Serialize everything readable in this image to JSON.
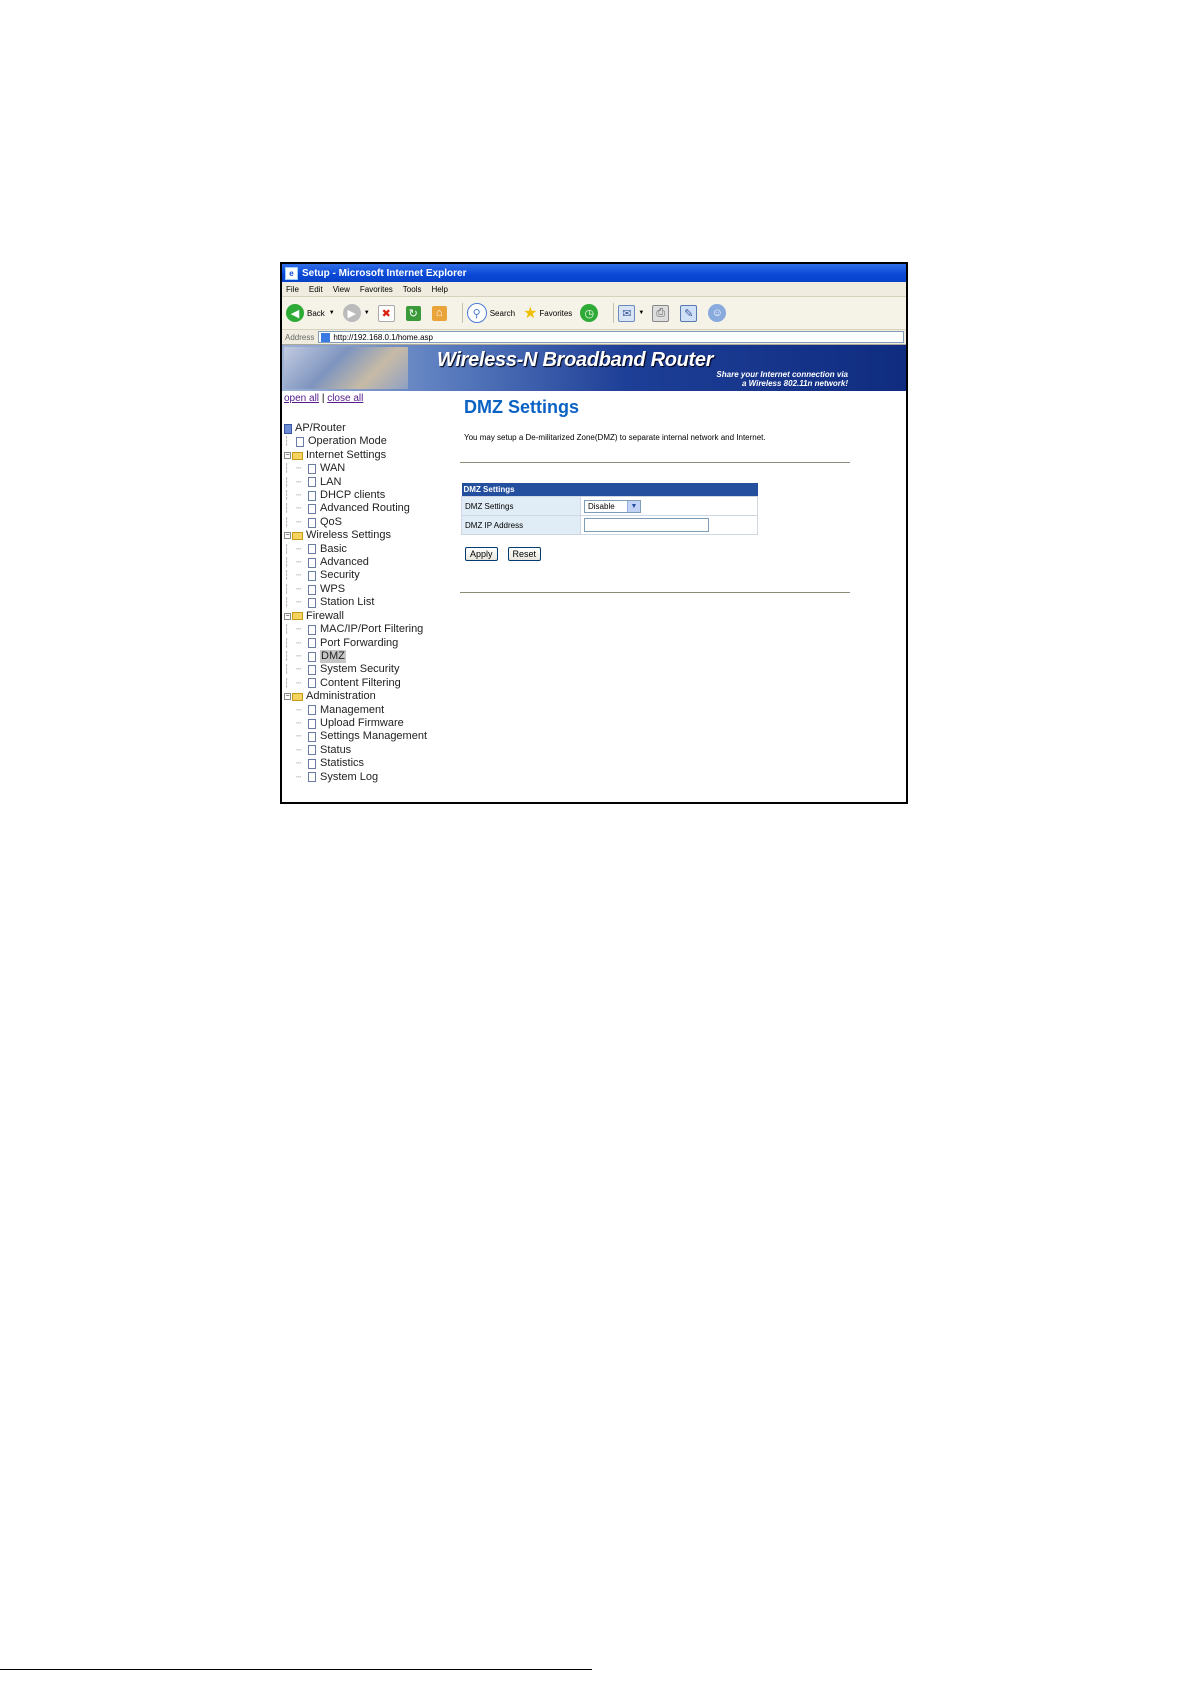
{
  "window": {
    "title": "Setup - Microsoft Internet Explorer"
  },
  "menu": [
    "File",
    "Edit",
    "View",
    "Favorites",
    "Tools",
    "Help"
  ],
  "toolbar": {
    "back": "Back",
    "search": "Search",
    "favorites": "Favorites"
  },
  "address": {
    "label": "Address",
    "url": "http://192.168.0.1/home.asp"
  },
  "banner": {
    "title": "Wireless-N Broadband Router",
    "tagline1": "Share your Internet connection via",
    "tagline2": "a Wireless 802.11n network!"
  },
  "nav": {
    "open_all": "open all",
    "separator": "|",
    "close_all": "close all",
    "root": "AP/Router",
    "operation_mode": "Operation Mode",
    "internet": {
      "label": "Internet Settings",
      "items": [
        "WAN",
        "LAN",
        "DHCP clients",
        "Advanced Routing",
        "QoS"
      ]
    },
    "wireless": {
      "label": "Wireless Settings",
      "items": [
        "Basic",
        "Advanced",
        "Security",
        "WPS",
        "Station List"
      ]
    },
    "firewall": {
      "label": "Firewall",
      "items": [
        "MAC/IP/Port Filtering",
        "Port Forwarding",
        "DMZ",
        "System Security",
        "Content Filtering"
      ]
    },
    "admin": {
      "label": "Administration",
      "items": [
        "Management",
        "Upload Firmware",
        "Settings Management",
        "Status",
        "Statistics",
        "System Log"
      ]
    }
  },
  "main": {
    "title": "DMZ Settings",
    "description": "You may setup a De-militarized Zone(DMZ) to separate internal network and Internet.",
    "table": {
      "header": "DMZ Settings",
      "row1_label": "DMZ Settings",
      "row1_value": "Disable",
      "row2_label": "DMZ IP Address",
      "row2_value": ""
    },
    "apply": "Apply",
    "reset": "Reset"
  }
}
